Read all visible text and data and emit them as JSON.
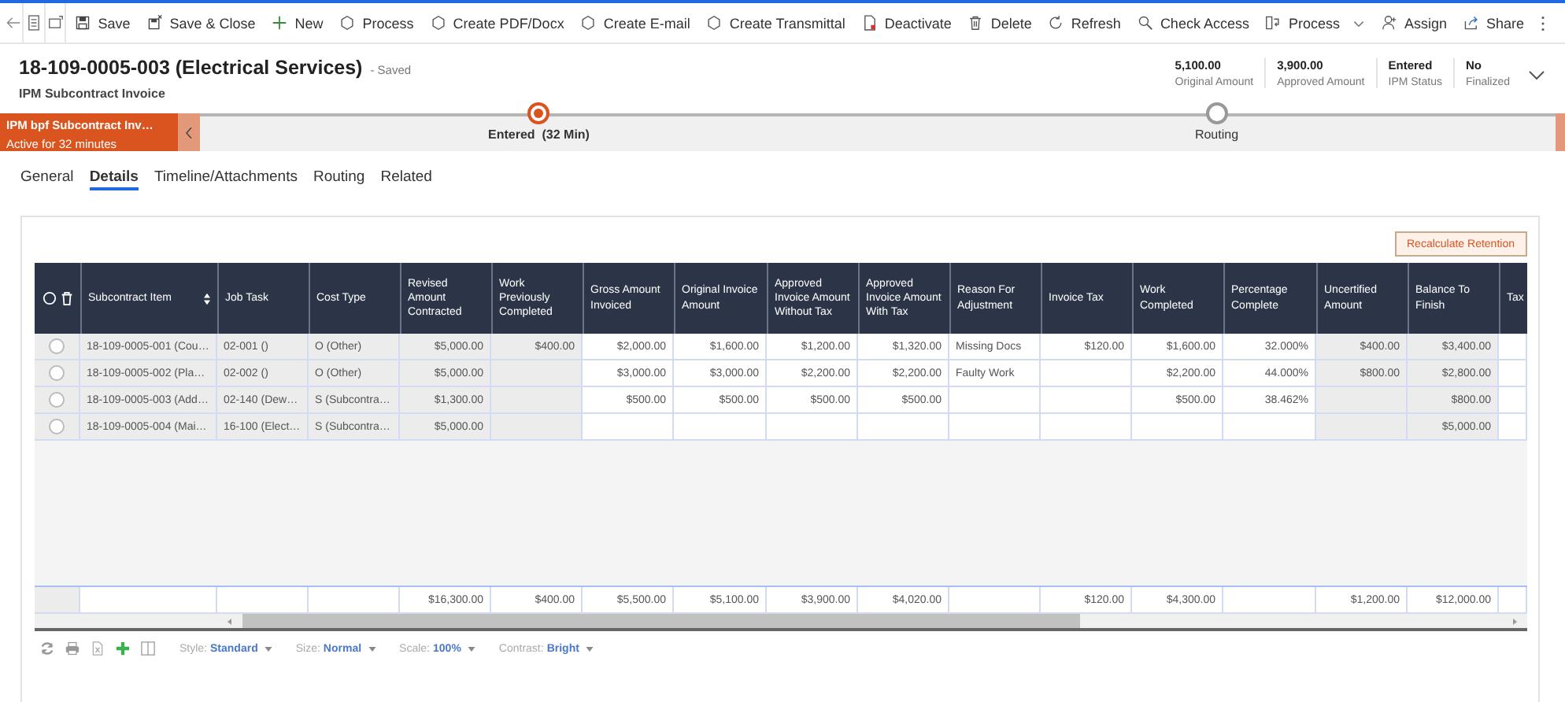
{
  "command_bar": {
    "items": [
      {
        "label": "Save",
        "has_menu": false
      },
      {
        "label": "Save & Close",
        "has_menu": false
      },
      {
        "label": "New",
        "has_menu": false
      },
      {
        "label": "Process",
        "has_menu": false
      },
      {
        "label": "Create PDF/Docx",
        "has_menu": false
      },
      {
        "label": "Create E-mail",
        "has_menu": false
      },
      {
        "label": "Create Transmittal",
        "has_menu": false
      },
      {
        "label": "Deactivate",
        "has_menu": false
      },
      {
        "label": "Delete",
        "has_menu": false
      },
      {
        "label": "Refresh",
        "has_menu": false
      },
      {
        "label": "Check Access",
        "has_menu": false
      },
      {
        "label": "Process",
        "has_menu": true
      },
      {
        "label": "Assign",
        "has_menu": false
      },
      {
        "label": "Share",
        "has_menu": false
      }
    ]
  },
  "header": {
    "title": "18-109-0005-003 (Electrical Services)",
    "save_status": "- Saved",
    "entity": "IPM Subcontract Invoice",
    "fields": [
      {
        "value": "5,100.00",
        "label": "Original Amount"
      },
      {
        "value": "3,900.00",
        "label": "Approved Amount"
      },
      {
        "value": "Entered",
        "label": "IPM Status"
      },
      {
        "value": "No",
        "label": "Finalized"
      }
    ]
  },
  "process": {
    "name": "IPM bpf Subcontract Inv…",
    "status": "Active for 32 minutes",
    "stages": [
      {
        "label": "Entered  (32 Min)",
        "selected": true
      },
      {
        "label": "Routing",
        "selected": false
      }
    ]
  },
  "tabs": [
    {
      "label": "General",
      "selected": false
    },
    {
      "label": "Details",
      "selected": true
    },
    {
      "label": "Timeline/Attachments",
      "selected": false
    },
    {
      "label": "Routing",
      "selected": false
    },
    {
      "label": "Related",
      "selected": false
    }
  ],
  "grid": {
    "action": "Recalculate Retention",
    "columns": [
      {
        "label": "Subcontract Item",
        "kind": "text",
        "shaded": true,
        "sortable": true
      },
      {
        "label": "Job Task",
        "kind": "text",
        "shaded": true,
        "sortable": false
      },
      {
        "label": "Cost Type",
        "kind": "text",
        "shaded": true,
        "sortable": false
      },
      {
        "label": "Revised Amount Contracted",
        "kind": "number",
        "shaded": true,
        "sortable": false
      },
      {
        "label": "Work Previously Completed",
        "kind": "number",
        "shaded": true,
        "sortable": false
      },
      {
        "label": "Gross Amount Invoiced",
        "kind": "number",
        "shaded": false,
        "sortable": false
      },
      {
        "label": "Original Invoice Amount",
        "kind": "number",
        "shaded": false,
        "sortable": false
      },
      {
        "label": "Approved Invoice Amount Without Tax",
        "kind": "number",
        "shaded": false,
        "sortable": false
      },
      {
        "label": "Approved Invoice Amount With Tax",
        "kind": "number",
        "shaded": false,
        "sortable": false
      },
      {
        "label": "Reason For Adjustment",
        "kind": "text",
        "shaded": false,
        "sortable": false
      },
      {
        "label": "Invoice Tax",
        "kind": "number",
        "shaded": false,
        "sortable": false
      },
      {
        "label": "Work Completed",
        "kind": "number",
        "shaded": false,
        "sortable": false
      },
      {
        "label": "Percentage Complete",
        "kind": "number",
        "shaded": false,
        "sortable": false
      },
      {
        "label": "Uncertified Amount",
        "kind": "number",
        "shaded": true,
        "sortable": false
      },
      {
        "label": "Balance To Finish",
        "kind": "number",
        "shaded": true,
        "sortable": false
      },
      {
        "label": "Tax",
        "kind": "number",
        "shaded": false,
        "sortable": false
      }
    ],
    "rows": [
      {
        "selected": false,
        "cells": [
          "18-109-0005-001 (Cou…",
          "02-001 ()",
          "O (Other)",
          "$5,000.00",
          "$400.00",
          "$2,000.00",
          "$1,600.00",
          "$1,200.00",
          "$1,320.00",
          "Missing Docs",
          "$120.00",
          "$1,600.00",
          "32.000%",
          "$400.00",
          "$3,400.00",
          null
        ]
      },
      {
        "selected": false,
        "cells": [
          "18-109-0005-002 (Pla…",
          "02-002 ()",
          "O (Other)",
          "$5,000.00",
          null,
          "$3,000.00",
          "$3,000.00",
          "$2,200.00",
          "$2,200.00",
          "Faulty Work",
          null,
          "$2,200.00",
          "44.000%",
          "$800.00",
          "$2,800.00",
          null
        ]
      },
      {
        "selected": false,
        "cells": [
          "18-109-0005-003 (Add…",
          "02-140 (Dew…",
          "S (Subcontra…",
          "$1,300.00",
          null,
          "$500.00",
          "$500.00",
          "$500.00",
          "$500.00",
          null,
          null,
          "$500.00",
          "38.462%",
          null,
          "$800.00",
          null
        ]
      },
      {
        "selected": false,
        "cells": [
          "18-109-0005-004 (Mai…",
          "16-100 (Elect…",
          "S (Subcontra…",
          "$5,000.00",
          null,
          null,
          null,
          null,
          null,
          null,
          null,
          null,
          null,
          null,
          "$5,000.00",
          null
        ]
      }
    ],
    "total_row": {
      "cells": [
        null,
        null,
        null,
        "$16,300.00",
        "$400.00",
        "$5,500.00",
        "$5,100.00",
        "$3,900.00",
        "$4,020.00",
        null,
        "$120.00",
        "$4,300.00",
        null,
        "$1,200.00",
        "$12,000.00",
        null
      ]
    },
    "options": [
      {
        "label": "Style:",
        "value": "Standard"
      },
      {
        "label": "Size:",
        "value": "Normal"
      },
      {
        "label": "Scale:",
        "value": "100%"
      },
      {
        "label": "Contrast:",
        "value": "Bright"
      }
    ]
  }
}
